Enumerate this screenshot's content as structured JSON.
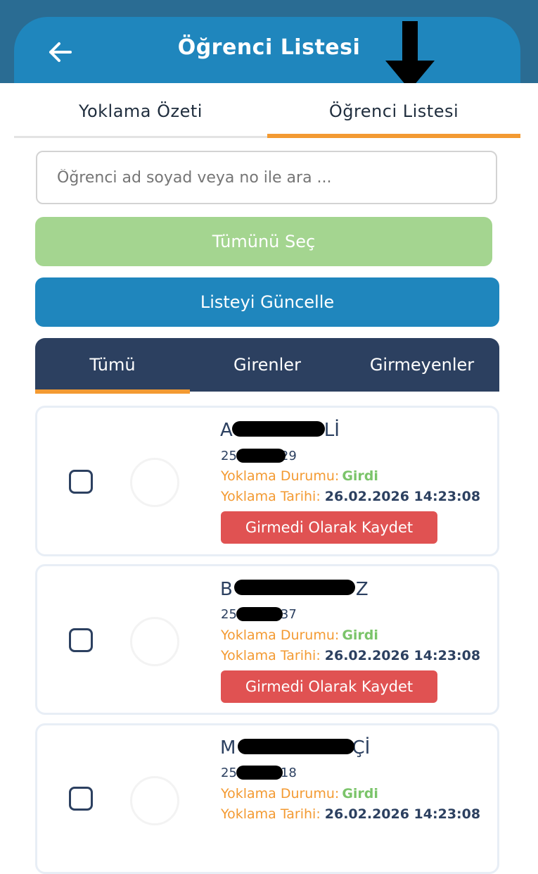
{
  "header": {
    "title": "Öğrenci Listesi"
  },
  "top_tabs": [
    {
      "label": "Yoklama Özeti"
    },
    {
      "label": "Öğrenci Listesi"
    }
  ],
  "search": {
    "placeholder": "Öğrenci ad soyad veya no ile ara ..."
  },
  "buttons": {
    "select_all": "Tümünü Seç",
    "update_list": "Listeyi Güncelle"
  },
  "filters": [
    {
      "label": "Tümü"
    },
    {
      "label": "Girenler"
    },
    {
      "label": "Girmeyenler"
    }
  ],
  "students": [
    {
      "name_start": "A",
      "name_end": "Lİ",
      "number_start": "25",
      "number_end": "29",
      "status_label": "Yoklama Durumu:",
      "status_value": "Girdi",
      "date_label": "Yoklama Tarihi:",
      "date_value": "26.02.2026 14:23:08",
      "action": "Girmedi Olarak Kaydet"
    },
    {
      "name_start": "B",
      "name_end": "Z",
      "number_start": "25",
      "number_end": "37",
      "status_label": "Yoklama Durumu:",
      "status_value": "Girdi",
      "date_label": "Yoklama Tarihi:",
      "date_value": "26.02.2026 14:23:08",
      "action": "Girmedi Olarak Kaydet"
    },
    {
      "name_start": "M",
      "name_end": "Çİ",
      "number_start": "25",
      "number_end": "18",
      "status_label": "Yoklama Durumu:",
      "status_value": "Girdi",
      "date_label": "Yoklama Tarihi:",
      "date_value": "26.02.2026 14:23:08",
      "action": "Girmedi Olarak Kaydet"
    }
  ],
  "colors": {
    "header": "#1f86bd",
    "header_outer": "#2a6c93",
    "accent_orange": "#f39a32",
    "select_all_green": "#a4d590",
    "filter_bar": "#2c4060",
    "status_green": "#7bc46a",
    "action_red": "#e05252"
  },
  "icons": {
    "back": "arrow-left-icon",
    "annotation": "arrow-down-icon"
  }
}
